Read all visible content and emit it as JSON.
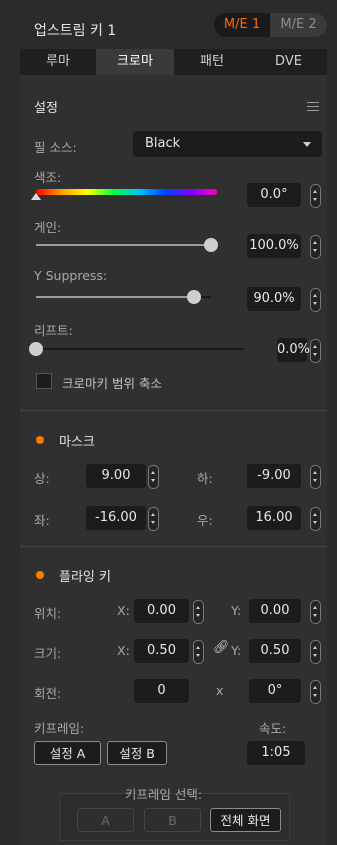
{
  "header": {
    "title": "업스트림 키 1",
    "me1": "M/E 1",
    "me2": "M/E 2"
  },
  "tabs": [
    "루마",
    "크로마",
    "패턴",
    "DVE"
  ],
  "settings": {
    "title": "설정",
    "fill_source_label": "필 소스:",
    "fill_source_value": "Black",
    "hue_label": "색조:",
    "hue_value": "0.0°",
    "gain_label": "게인:",
    "gain_value": "100.0%",
    "gain_level": 1.0,
    "ysuppress_label": "Y Suppress:",
    "ysuppress_value": "90.0%",
    "ysuppress_level": 0.9,
    "lift_label": "리프트:",
    "lift_value": "0.0%",
    "lift_level": 0.0,
    "narrow_label": "크로마키 범위 축소"
  },
  "mask": {
    "title": "마스크",
    "top_label": "상:",
    "top_value": "9.00",
    "bottom_label": "하:",
    "bottom_value": "-9.00",
    "left_label": "좌:",
    "left_value": "-16.00",
    "right_label": "우:",
    "right_value": "16.00"
  },
  "flying": {
    "title": "플라잉 키",
    "pos_label": "위치:",
    "pos_x_label": "X:",
    "pos_x": "0.00",
    "pos_y_label": "Y:",
    "pos_y": "0.00",
    "size_label": "크기:",
    "size_x_label": "X:",
    "size_x": "0.50",
    "size_y_label": "Y:",
    "size_y": "0.50",
    "rot_label": "회전:",
    "rot_a": "0",
    "rot_x": "x",
    "rot_b": "0°",
    "keyframe_label": "키프레임:",
    "speed_label": "속도:",
    "set_a": "설정 A",
    "set_b": "설정 B",
    "speed_value": "1:05",
    "kf_select_label": "키프레임 선택:",
    "kf_a": "A",
    "kf_b": "B",
    "kf_full": "전체 화면"
  }
}
